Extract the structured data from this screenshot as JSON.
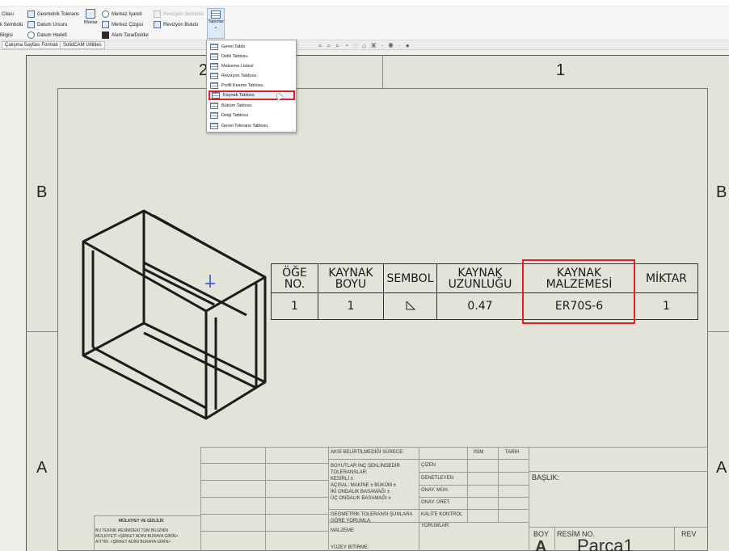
{
  "ribbon": {
    "left_col": [
      "Cilası",
      "k Sembolü",
      "Bilgisi"
    ],
    "col2": [
      "Geometrik Tolerans",
      "Datum Ursuru",
      "Datum Hedefi"
    ],
    "bloklar": "Bloklar",
    "col4": [
      "Merkez İşareti",
      "Merkez Çizgisi",
      "Alanı Tara/Doldur"
    ],
    "col5": [
      "Revizyon Sembolü",
      "Revizyon Bulutu"
    ],
    "tablolar": "Tablolar"
  },
  "tabs": [
    "Çalışma Sayfası Formatı",
    "SolidCAM Utilities"
  ],
  "zones": {
    "top_left": "2",
    "top_right": "1",
    "mid_left": "B",
    "mid_right": "B",
    "low_left": "A",
    "low_right": "A"
  },
  "menu": {
    "items": [
      "Genel Tablo",
      "Delik Tablosu",
      "Malzeme Listesi",
      "Revizyon Tablosu",
      "Profil Kesme Tablosu",
      "Kaynak Tablosu",
      "Büküm Tablosu",
      "Delgi Tablosu",
      "Genel Tolerans Tablosu"
    ],
    "active_index": 5
  },
  "weld_table": {
    "headers": [
      "ÖĞE\nNO.",
      "KAYNAK\nBOYU",
      "SEMBOL",
      "KAYNAK\nUZUNLUĞU",
      "KAYNAK\nMALZEMESİ",
      "MİKTAR"
    ],
    "row": [
      "1",
      "1",
      "",
      "0.47",
      "ER70S-6",
      "1"
    ],
    "highlighted_column": "KAYNAK\nMALZEMESİ"
  },
  "title_block": {
    "aksi": "AKSİ BELİRTİLMEDİĞİ SÜRECE:",
    "isim": "İSİM",
    "tarih": "TARİH",
    "boyutlar": "BOYUTLAR İNÇ ŞEKLİNDEDİR",
    "toleranslar": "TOLERANSLAR:",
    "kesirli": "KESİRLİ ±",
    "acisal": "AÇISAL: MAKİNE ±    BÜKÜM ±",
    "iki_ondalik": "İKİ ONDALIK BASAMAĞI  ±",
    "uc_ondalik": "ÜÇ ONDALIK BASAMAĞI  ±",
    "geometrik": "GEOMETRİK TOLERANSI ŞUNLARA",
    "gore": "GÖRE YORUMLA:",
    "malzeme": "MALZEME",
    "yuzey": "YÜZEY BİTİRME:",
    "cizen": "ÇİZEN",
    "denetleyen": "DENETLEYEN",
    "onay_muh": "ONAY. MÜH.",
    "onay_uret": "ONAY. ÜRET.",
    "kalite": "KALİTE KONTROL",
    "yorumlar": "YORUMLAR:",
    "baslik": "BAŞLIK:",
    "boy": "BOY",
    "resim_no": "RESİM  NO.",
    "rev": "REV",
    "boy_value": "A",
    "parca": "Parça1",
    "mulkiyet_title": "MÜLKİYET VE GİZLİLİK",
    "mulkiyet_l1": "BU TEKNİK RESİMDEKİ TÜM BİLGİNİN",
    "mulkiyet_l2": "MÜLKİYETİ <ŞİRKET ADINI BURAYA GİRİN>",
    "mulkiyet_l3": "AİTTİR. <ŞİRKET ADINI BURAYA GİRİN>"
  }
}
